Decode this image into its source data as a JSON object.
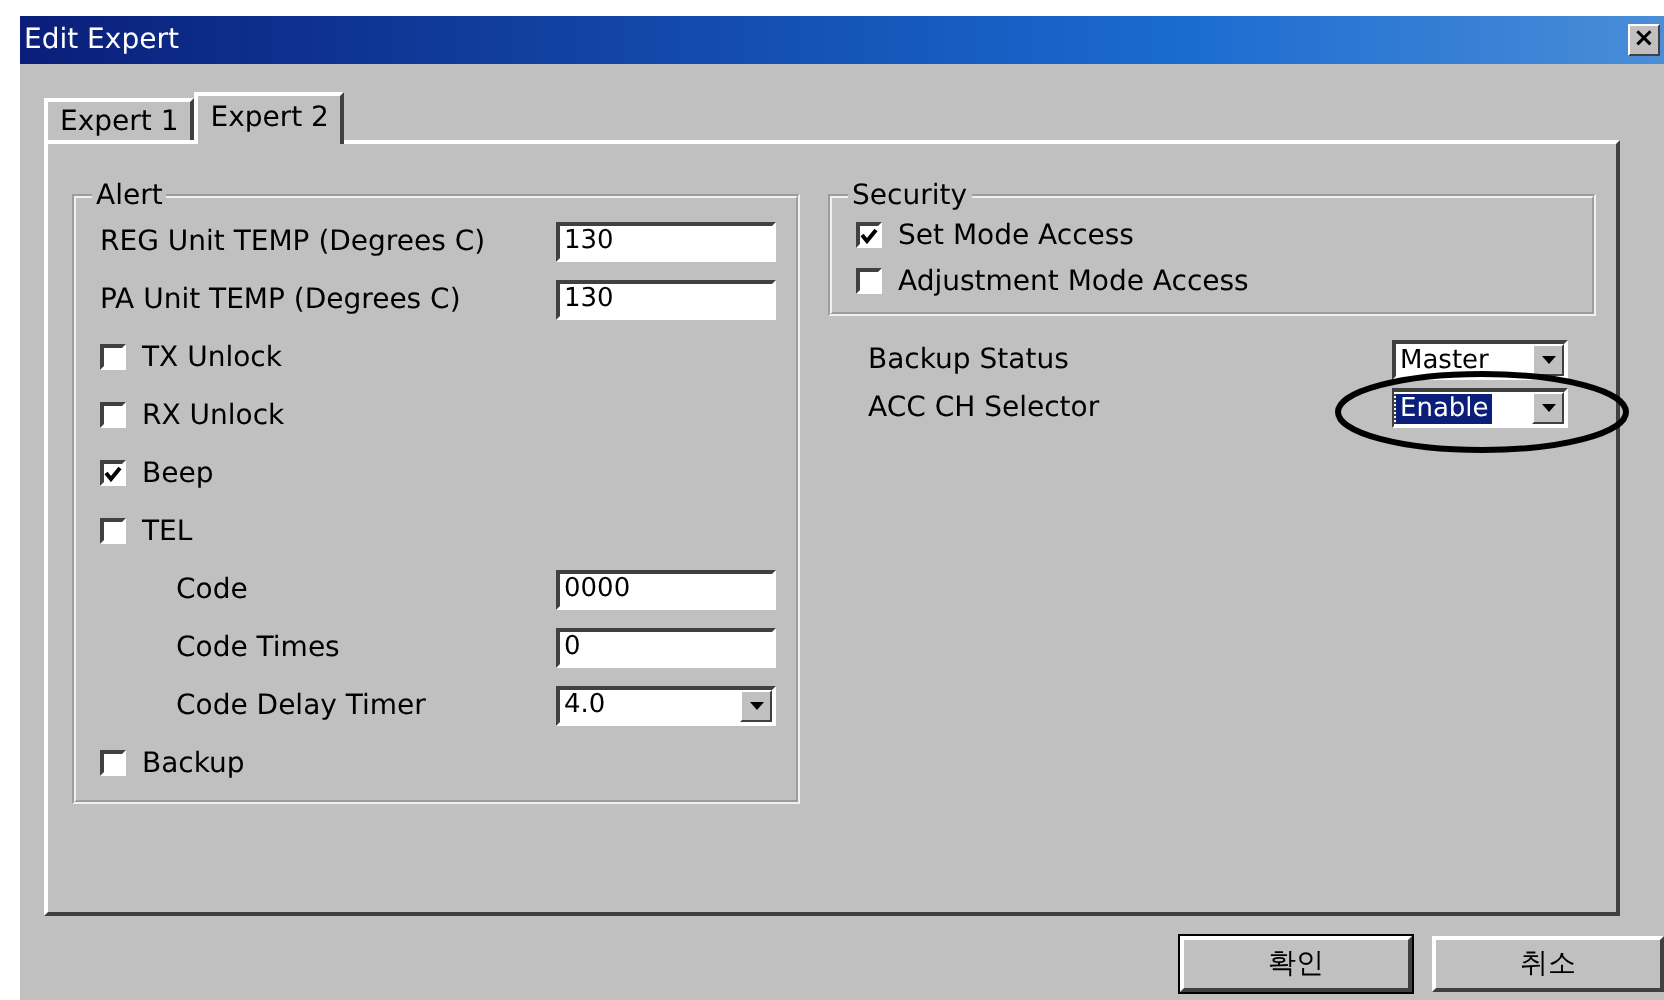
{
  "window": {
    "title": "Edit Expert",
    "close": "×"
  },
  "tabs": [
    {
      "label": "Expert 1",
      "selected": false
    },
    {
      "label": "Expert 2",
      "selected": true
    }
  ],
  "alert": {
    "title": "Alert",
    "items": [
      {
        "kind": "text",
        "label": "REG Unit TEMP (Degrees C)",
        "value": "130"
      },
      {
        "kind": "text",
        "label": "PA Unit TEMP (Degrees C)",
        "value": "130"
      },
      {
        "kind": "check",
        "label": "TX Unlock",
        "checked": false
      },
      {
        "kind": "check",
        "label": "RX Unlock",
        "checked": false
      },
      {
        "kind": "check",
        "label": "Beep",
        "checked": true
      },
      {
        "kind": "check",
        "label": "TEL",
        "checked": false,
        "children": [
          {
            "kind": "text",
            "label": "Code",
            "value": "0000"
          },
          {
            "kind": "text",
            "label": "Code Times",
            "value": "0"
          },
          {
            "kind": "select",
            "label": "Code Delay Timer",
            "value": "4.0"
          }
        ]
      },
      {
        "kind": "check",
        "label": "Backup",
        "checked": false
      }
    ]
  },
  "security": {
    "title": "Security",
    "items": [
      {
        "label": "Set Mode Access",
        "checked": true
      },
      {
        "label": "Adjustment Mode Access",
        "checked": false
      }
    ]
  },
  "settings": [
    {
      "label": "Backup Status",
      "value": "Master",
      "focused": false,
      "circled": false
    },
    {
      "label": "ACC CH Selector",
      "value": "Enable",
      "focused": true,
      "circled": true
    }
  ],
  "buttons": [
    {
      "label": "확인",
      "default": true
    },
    {
      "label": "취소",
      "default": false
    }
  ]
}
